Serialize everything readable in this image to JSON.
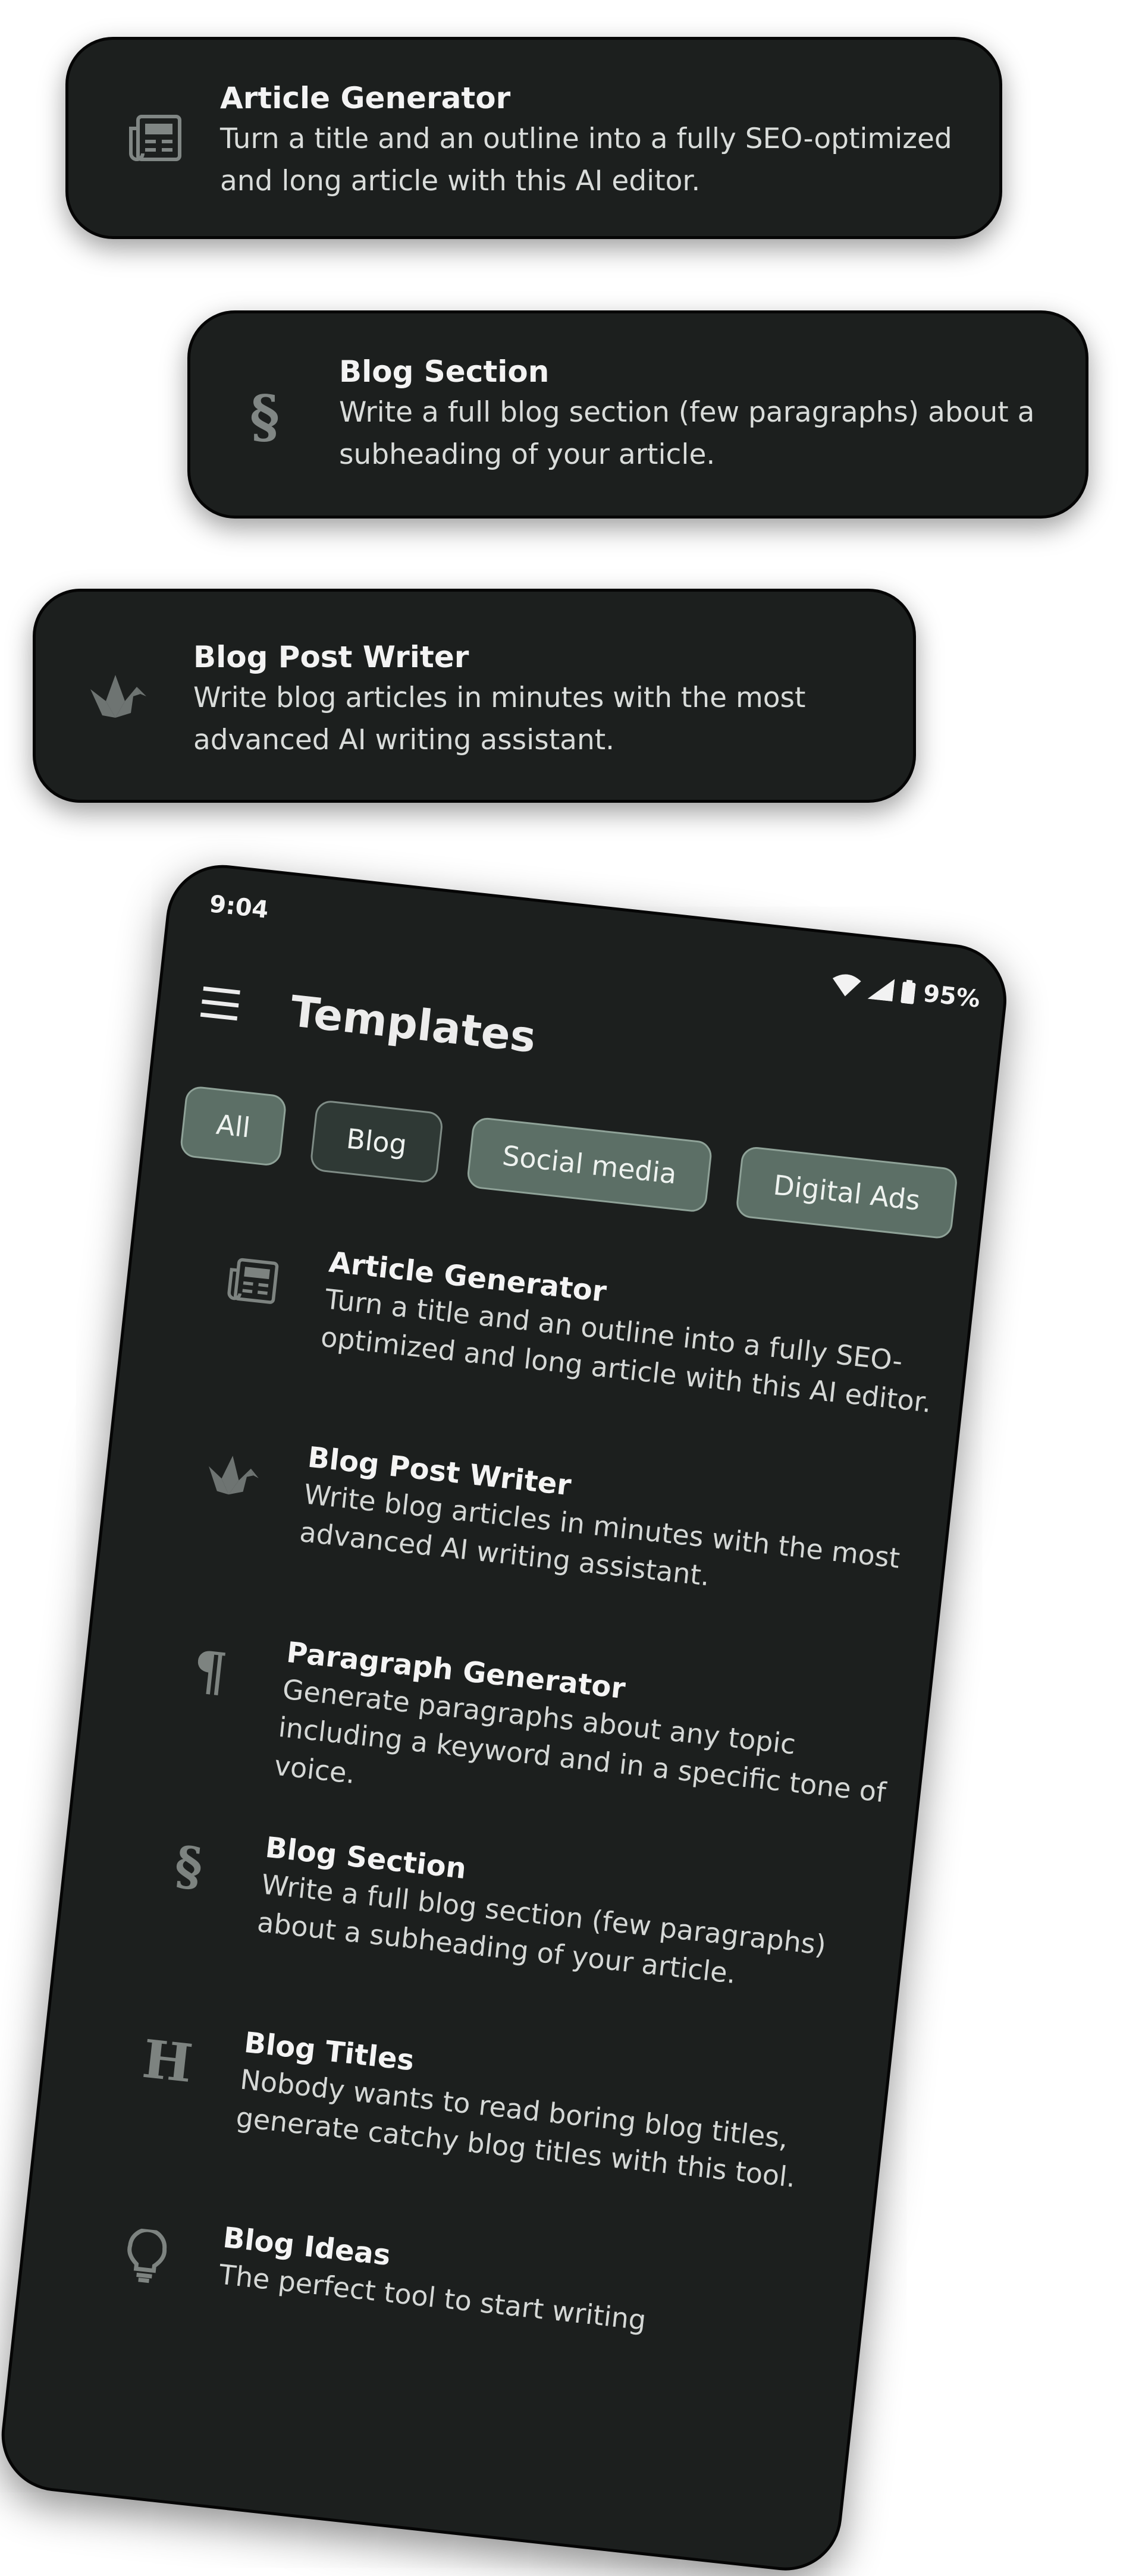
{
  "cards": [
    {
      "title": "Article Generator",
      "desc": "Turn a title and an outline into a fully SEO-optimized and long article with this AI editor."
    },
    {
      "title": "Blog Section",
      "desc": "Write a full blog section (few paragraphs) about a subheading of your article."
    },
    {
      "title": "Blog Post Writer",
      "desc": "Write blog articles in minutes with the most advanced AI writing assistant."
    }
  ],
  "phone": {
    "status": {
      "time": "9:04",
      "battery": "95%"
    },
    "title": "Templates",
    "chips": [
      "All",
      "Blog",
      "Social media",
      "Digital Ads"
    ],
    "items": [
      {
        "title": "Article Generator",
        "desc": "Turn a title and an outline into a fully SEO-optimized and long article with this AI editor.",
        "icon": "newspaper-icon"
      },
      {
        "title": "Blog Post Writer",
        "desc": "Write blog articles in minutes with the most advanced AI writing assistant.",
        "icon": "origami-crane-icon"
      },
      {
        "title": "Paragraph Generator",
        "desc": "Generate paragraphs about any topic including a keyword and in a specific tone of voice.",
        "icon": "pilcrow-icon",
        "glyph": "¶"
      },
      {
        "title": "Blog Section",
        "desc": "Write a full blog section (few paragraphs) about a subheading of your article.",
        "icon": "section-icon",
        "glyph": "§"
      },
      {
        "title": "Blog Titles",
        "desc": "Nobody wants to read boring blog titles, generate catchy blog titles with this tool.",
        "icon": "heading-icon",
        "glyph": "H"
      },
      {
        "title": "Blog Ideas",
        "desc": "The perfect tool to start writing",
        "icon": "lightbulb-icon"
      }
    ]
  }
}
